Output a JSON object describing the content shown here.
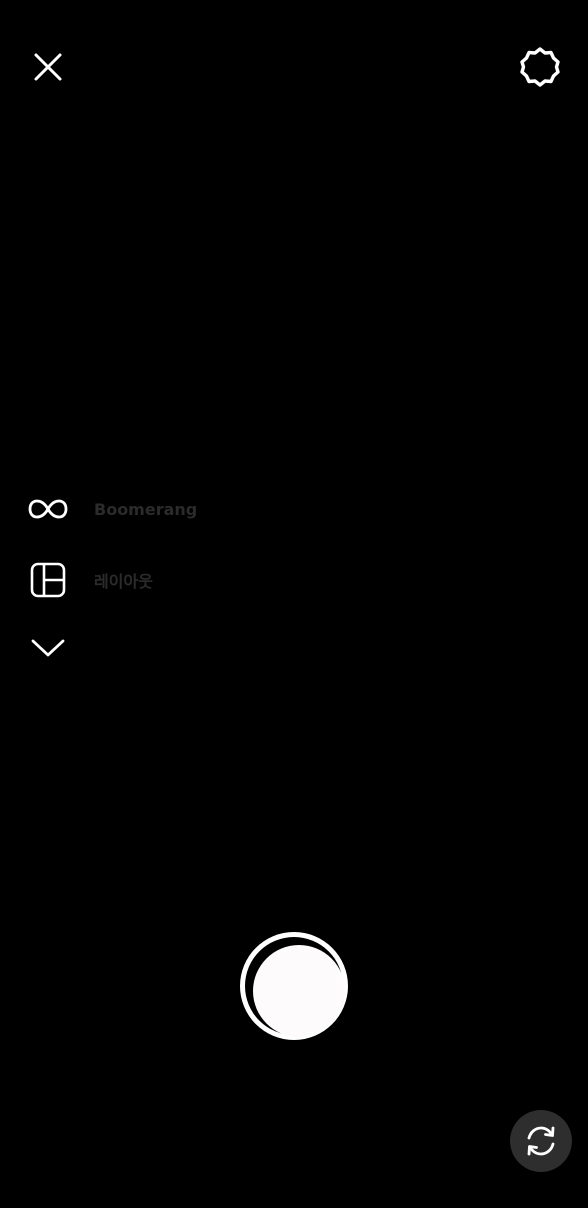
{
  "top_bar": {
    "close_icon": "close-icon",
    "settings_icon": "gear-icon"
  },
  "modes": {
    "items": [
      {
        "icon": "infinity-icon",
        "label": "Boomerang"
      },
      {
        "icon": "layout-icon",
        "label": "레이아웃"
      }
    ],
    "expand_icon": "chevron-down-icon"
  },
  "controls": {
    "shutter": "shutter-button",
    "flip_icon": "camera-flip-icon"
  },
  "colors": {
    "background": "#000000",
    "icon": "#ffffff",
    "label_dim": "#2b2b2b",
    "flip_bg": "#2e2e2e"
  }
}
